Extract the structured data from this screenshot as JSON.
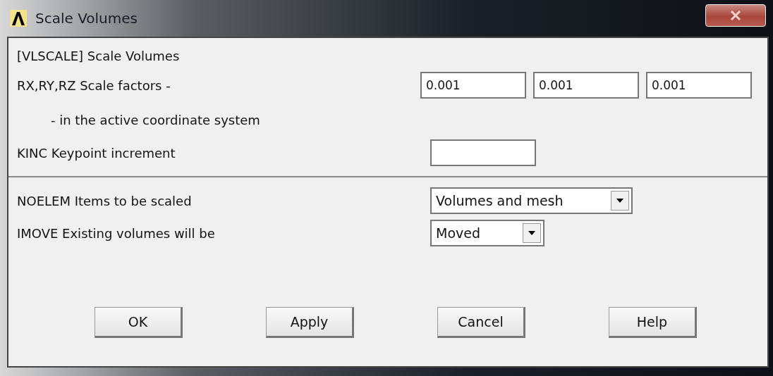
{
  "window": {
    "title": "Scale Volumes"
  },
  "header": "[VLSCALE]  Scale Volumes",
  "fields": [
    {
      "kind": "triple",
      "label": "RX,RY,RZ  Scale factors -",
      "values": [
        "0.001",
        "0.001",
        "0.001"
      ]
    },
    {
      "kind": "note",
      "label": "- in the active coordinate system"
    },
    {
      "kind": "single",
      "label": "KINC   Keypoint increment"
    }
  ],
  "options": [
    {
      "kind": "wide",
      "label": "NOELEM  Items to be scaled",
      "value": "Volumes and mesh"
    },
    {
      "kind": "narrow",
      "label": "IMOVE  Existing volumes will be",
      "value": "Moved"
    }
  ],
  "buttons": [
    "OK",
    "Apply",
    "Cancel",
    "Help"
  ]
}
